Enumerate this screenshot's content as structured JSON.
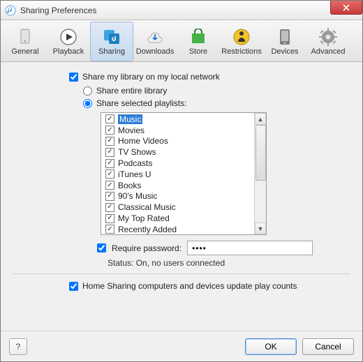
{
  "window": {
    "title": "Sharing Preferences"
  },
  "toolbar": {
    "items": [
      {
        "label": "General"
      },
      {
        "label": "Playback"
      },
      {
        "label": "Sharing"
      },
      {
        "label": "Downloads"
      },
      {
        "label": "Store"
      },
      {
        "label": "Restrictions"
      },
      {
        "label": "Devices"
      },
      {
        "label": "Advanced"
      }
    ],
    "selected_index": 2
  },
  "share": {
    "share_library_label": "Share my library on my local network",
    "share_library_checked": true,
    "entire_label": "Share entire library",
    "selected_label": "Share selected playlists:",
    "mode": "selected",
    "playlists": [
      {
        "name": "Music",
        "checked": true,
        "selected": true
      },
      {
        "name": "Movies",
        "checked": true
      },
      {
        "name": "Home Videos",
        "checked": true
      },
      {
        "name": "TV Shows",
        "checked": true
      },
      {
        "name": "Podcasts",
        "checked": true
      },
      {
        "name": "iTunes U",
        "checked": true
      },
      {
        "name": "Books",
        "checked": true
      },
      {
        "name": "90's Music",
        "checked": true
      },
      {
        "name": "Classical Music",
        "checked": true
      },
      {
        "name": "My Top Rated",
        "checked": true
      },
      {
        "name": "Recently Added",
        "checked": true
      }
    ]
  },
  "password": {
    "require_label": "Require password:",
    "require_checked": true,
    "value": "••••"
  },
  "status": {
    "prefix": "Status:",
    "text": "On, no users connected"
  },
  "homeshare": {
    "label": "Home Sharing computers and devices update play counts",
    "checked": true
  },
  "buttons": {
    "help": "?",
    "ok": "OK",
    "cancel": "Cancel"
  }
}
